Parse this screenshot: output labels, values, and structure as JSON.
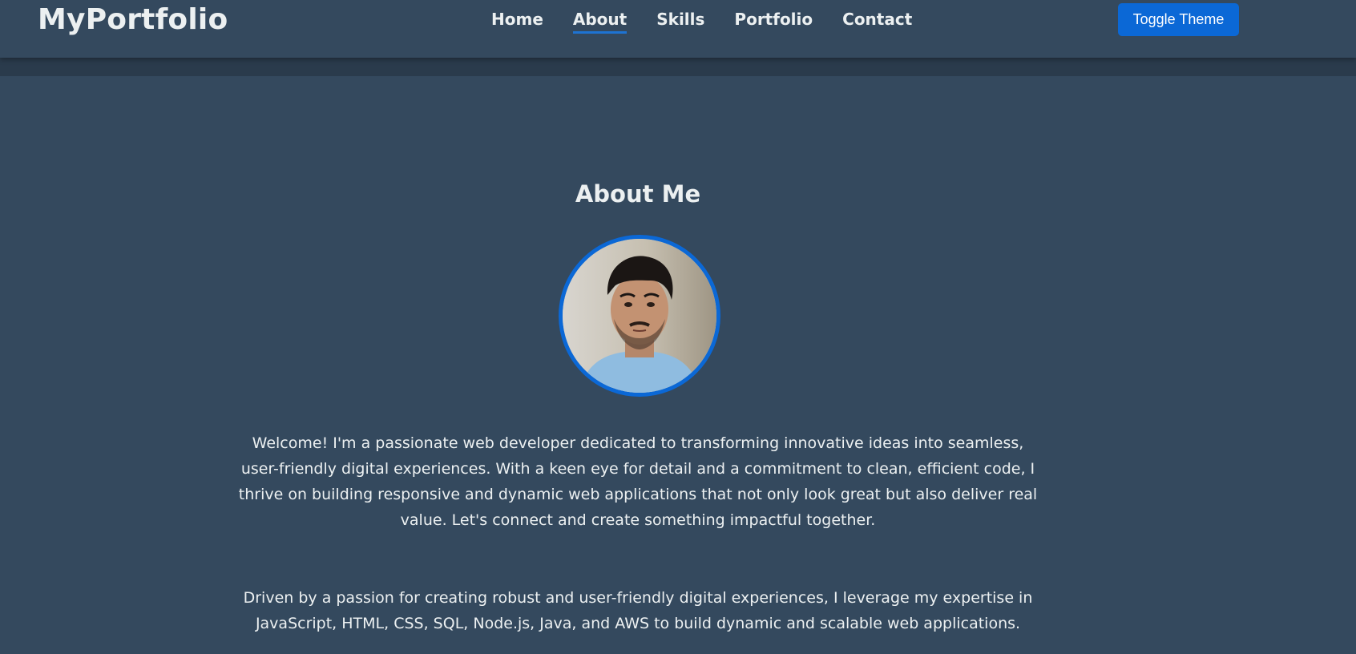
{
  "nav": {
    "logo": "MyPortfolio",
    "links": [
      "Home",
      "About",
      "Skills",
      "Portfolio",
      "Contact"
    ],
    "active": "About",
    "toggle_label": "Toggle Theme"
  },
  "about": {
    "title": "About Me",
    "paragraph1": "Welcome! I'm a passionate web developer dedicated to transforming innovative ideas into seamless, user-friendly digital experiences. With a keen eye for detail and a commitment to clean, efficient code, I thrive on building responsive and dynamic web applications that not only look great but also deliver real value. Let's connect and create something impactful together.",
    "paragraph2": "Driven by a passion for creating robust and user-friendly digital experiences, I leverage my expertise in JavaScript, HTML, CSS, SQL, Node.js, Java, and AWS to build dynamic and scalable web applications."
  },
  "colors": {
    "background": "#34495e",
    "accent": "#0b68d6",
    "text": "#ecf0f1"
  }
}
